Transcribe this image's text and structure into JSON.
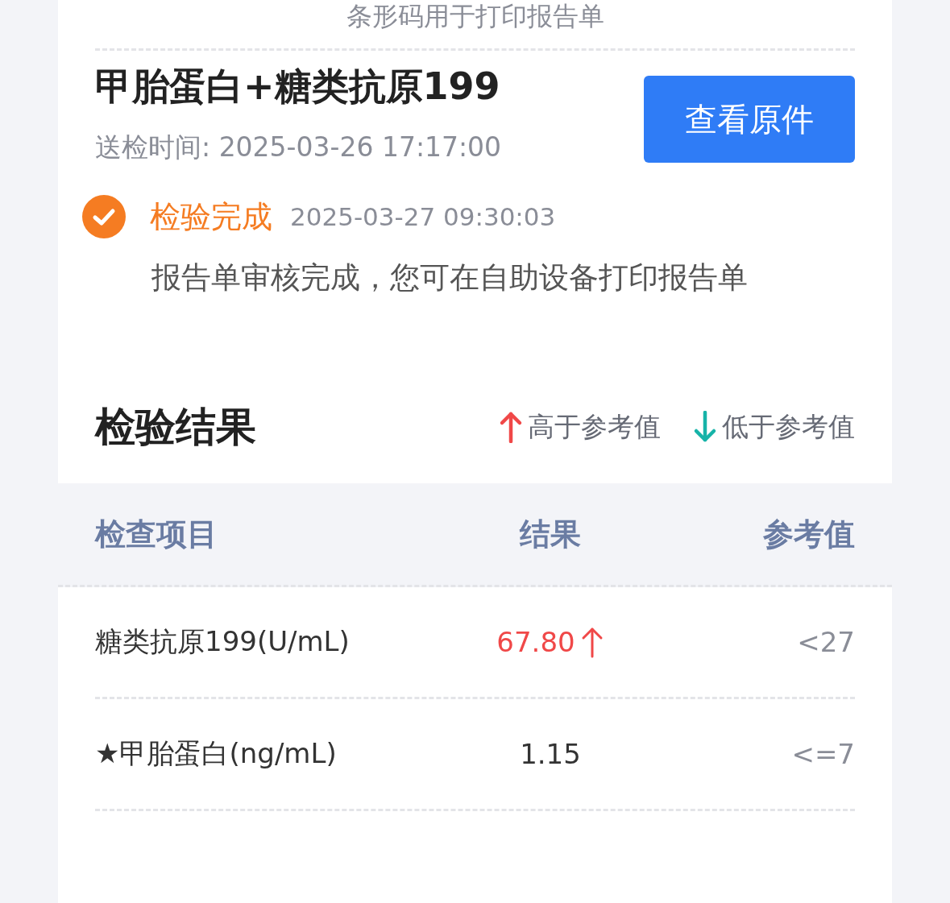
{
  "barcode_note": "条形码用于打印报告单",
  "report": {
    "title": "甲胎蛋白+糖类抗原199",
    "sent_label": "送检时间:",
    "sent_time": "2025-03-26 17:17:00",
    "view_button": "查看原件"
  },
  "status": {
    "done": true,
    "label": "检验完成",
    "time": "2025-03-27 09:30:03",
    "message": "报告单审核完成，您可在自助设备打印报告单"
  },
  "results": {
    "title": "检验结果",
    "legend": [
      {
        "kind": "high",
        "label": "高于参考值"
      },
      {
        "kind": "low",
        "label": "低于参考值"
      }
    ],
    "columns": [
      "检查项目",
      "结果",
      "参考值"
    ],
    "rows": [
      {
        "item": "糖类抗原199(U/mL)",
        "result": "67.80",
        "kind": "high",
        "reference": "<27"
      },
      {
        "item": "★甲胎蛋白(ng/mL)",
        "result": "1.15",
        "kind": "normal",
        "reference": "<=7"
      }
    ]
  }
}
